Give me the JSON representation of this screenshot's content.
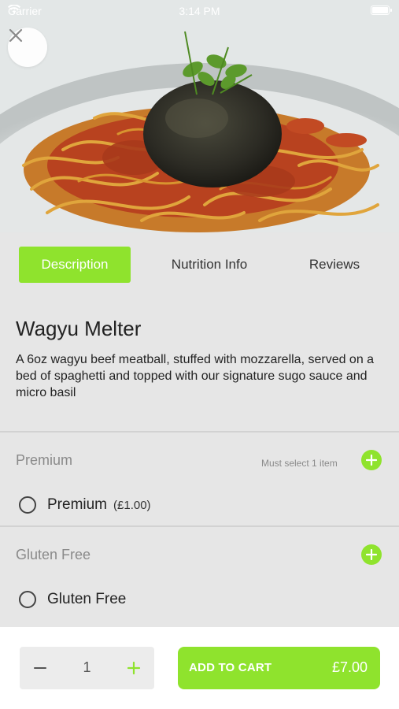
{
  "status_bar": {
    "carrier": "Carrier",
    "time": "3:14 PM",
    "wifi_icon": "wifi-icon",
    "battery_icon": "battery-icon"
  },
  "hero": {
    "image": "spaghetti-meatball-photo",
    "close_icon": "close-icon"
  },
  "tabs": [
    {
      "label": "Description",
      "active": true
    },
    {
      "label": "Nutrition Info",
      "active": false
    },
    {
      "label": "Reviews",
      "active": false
    }
  ],
  "product": {
    "title": "Wagyu Melter",
    "description": "A 6oz wagyu beef meatball, stuffed with mozzarella, served on a bed of spaghetti and topped with our signature sugo sauce and micro basil"
  },
  "option_groups": [
    {
      "title": "Premium",
      "note": "Must select 1 item",
      "options": [
        {
          "name": "Premium",
          "price": "(£1.00)",
          "selected": false
        }
      ]
    },
    {
      "title": "Gluten Free",
      "note": "",
      "options": [
        {
          "name": "Gluten Free",
          "price": "",
          "selected": false
        }
      ]
    }
  ],
  "cart": {
    "quantity": "1",
    "add_label": "ADD TO CART",
    "price": "£7.00"
  },
  "colors": {
    "accent": "#8fe32d",
    "background": "#e6e6e6",
    "bottom_bar": "#ffffff"
  }
}
